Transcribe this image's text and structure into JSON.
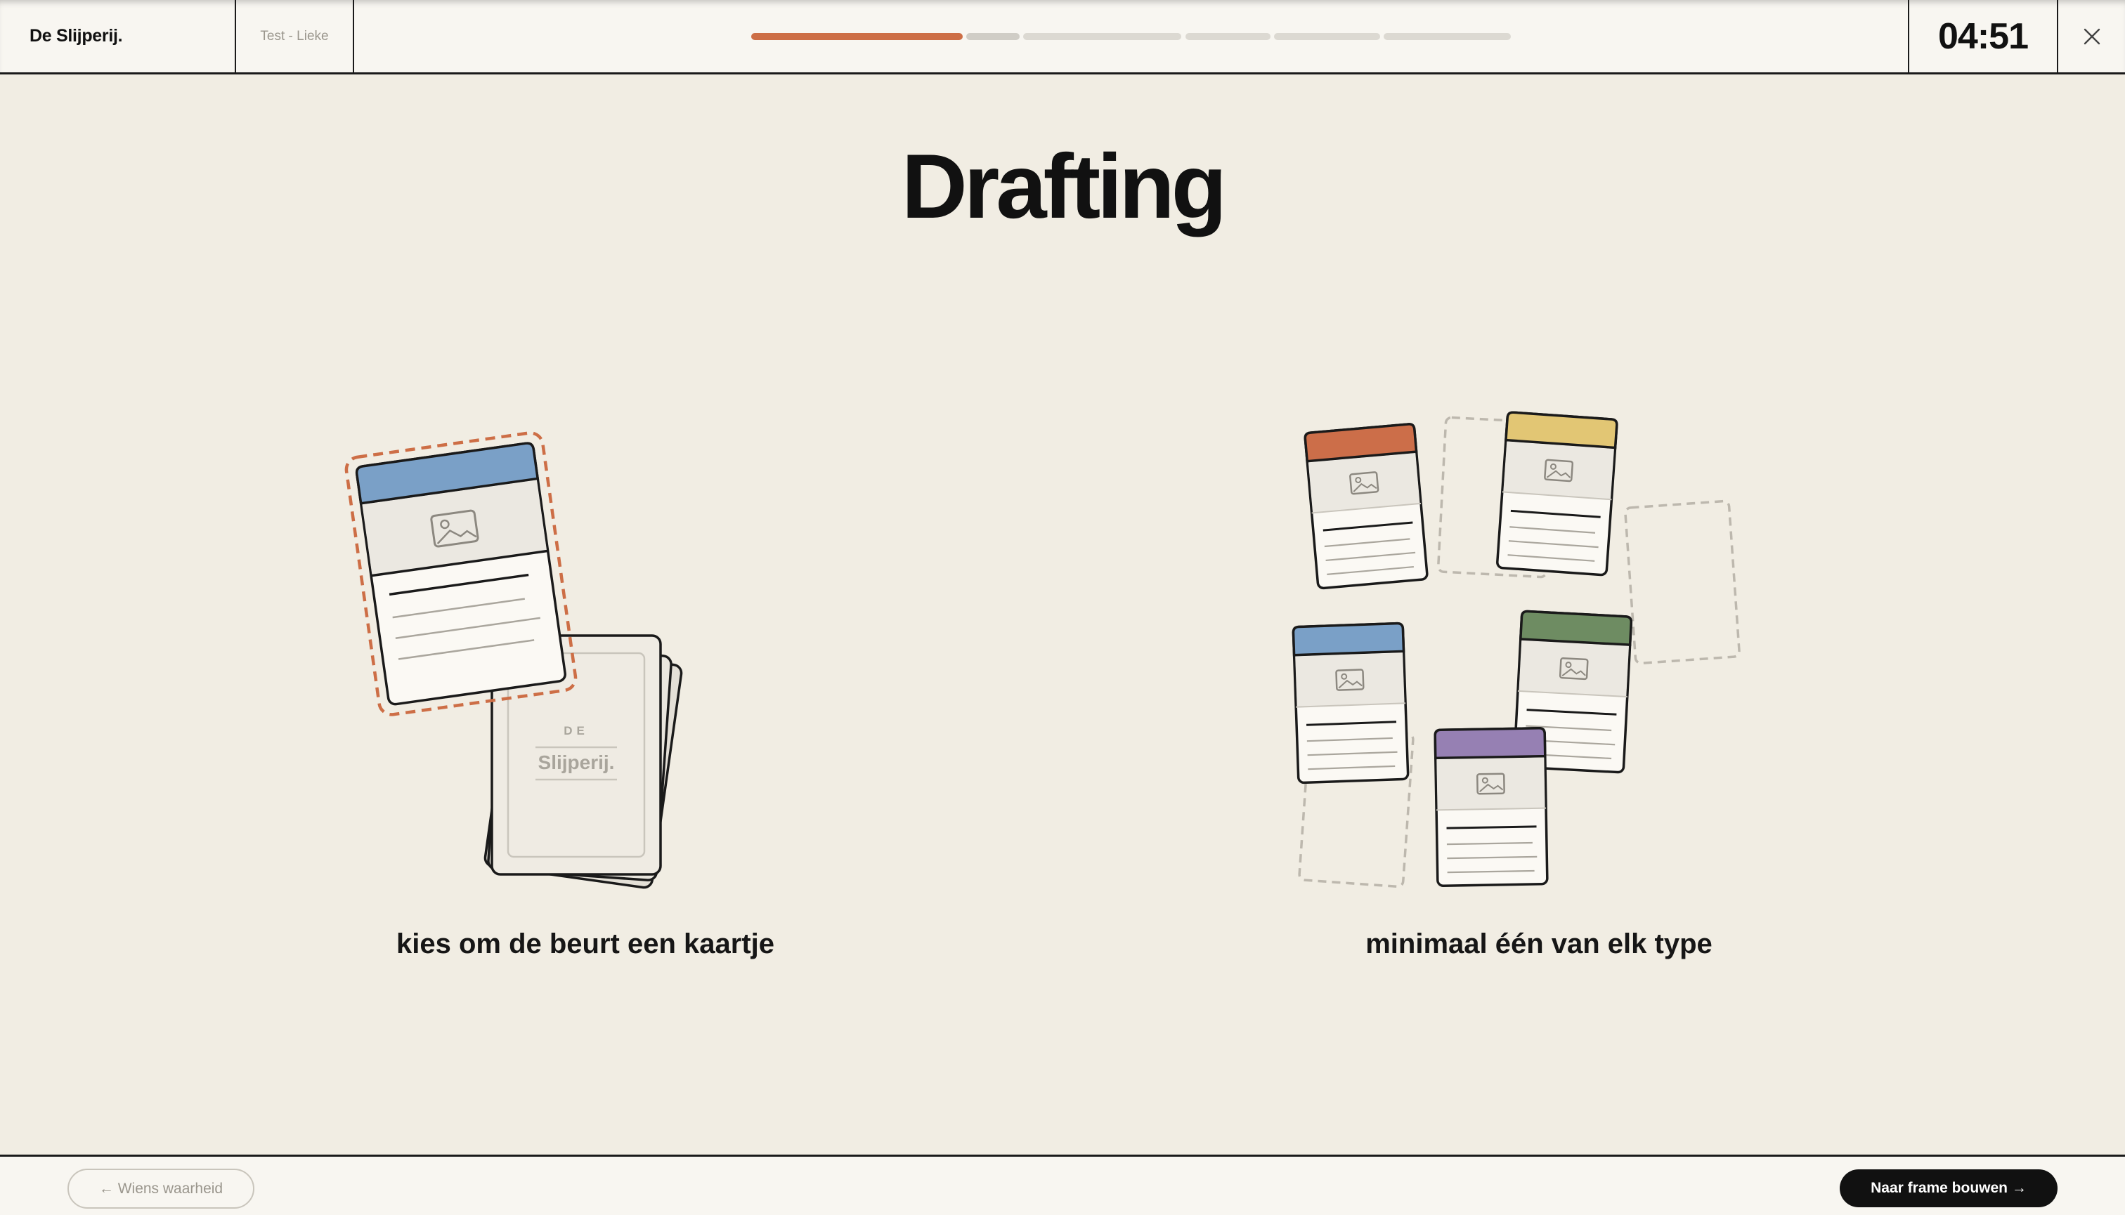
{
  "header": {
    "brand": "De Slijperij.",
    "session": "Test - Lieke",
    "timer": "04:51",
    "progress": {
      "segments": 6,
      "current": 1,
      "colors": {
        "done": "#cd6e46",
        "current": "#d0cdc6",
        "upcoming": "#dcd9d2"
      }
    }
  },
  "main": {
    "title": "Drafting",
    "steps": [
      {
        "caption": "kies om de beurt een kaartje"
      },
      {
        "caption": "minimaal één van elk type"
      }
    ],
    "deck": {
      "label_top": "DE",
      "label_bottom": "Slijperij."
    },
    "card_colors": {
      "orange": "#cc6e49",
      "yellow": "#e2c674",
      "blue": "#7aa0c7",
      "green": "#6e8c62",
      "purple": "#9680b3",
      "highlight": "#cd6e46"
    }
  },
  "footer": {
    "back_label": "← Wiens waarheid",
    "next_label": "Naar frame bouwen →"
  }
}
